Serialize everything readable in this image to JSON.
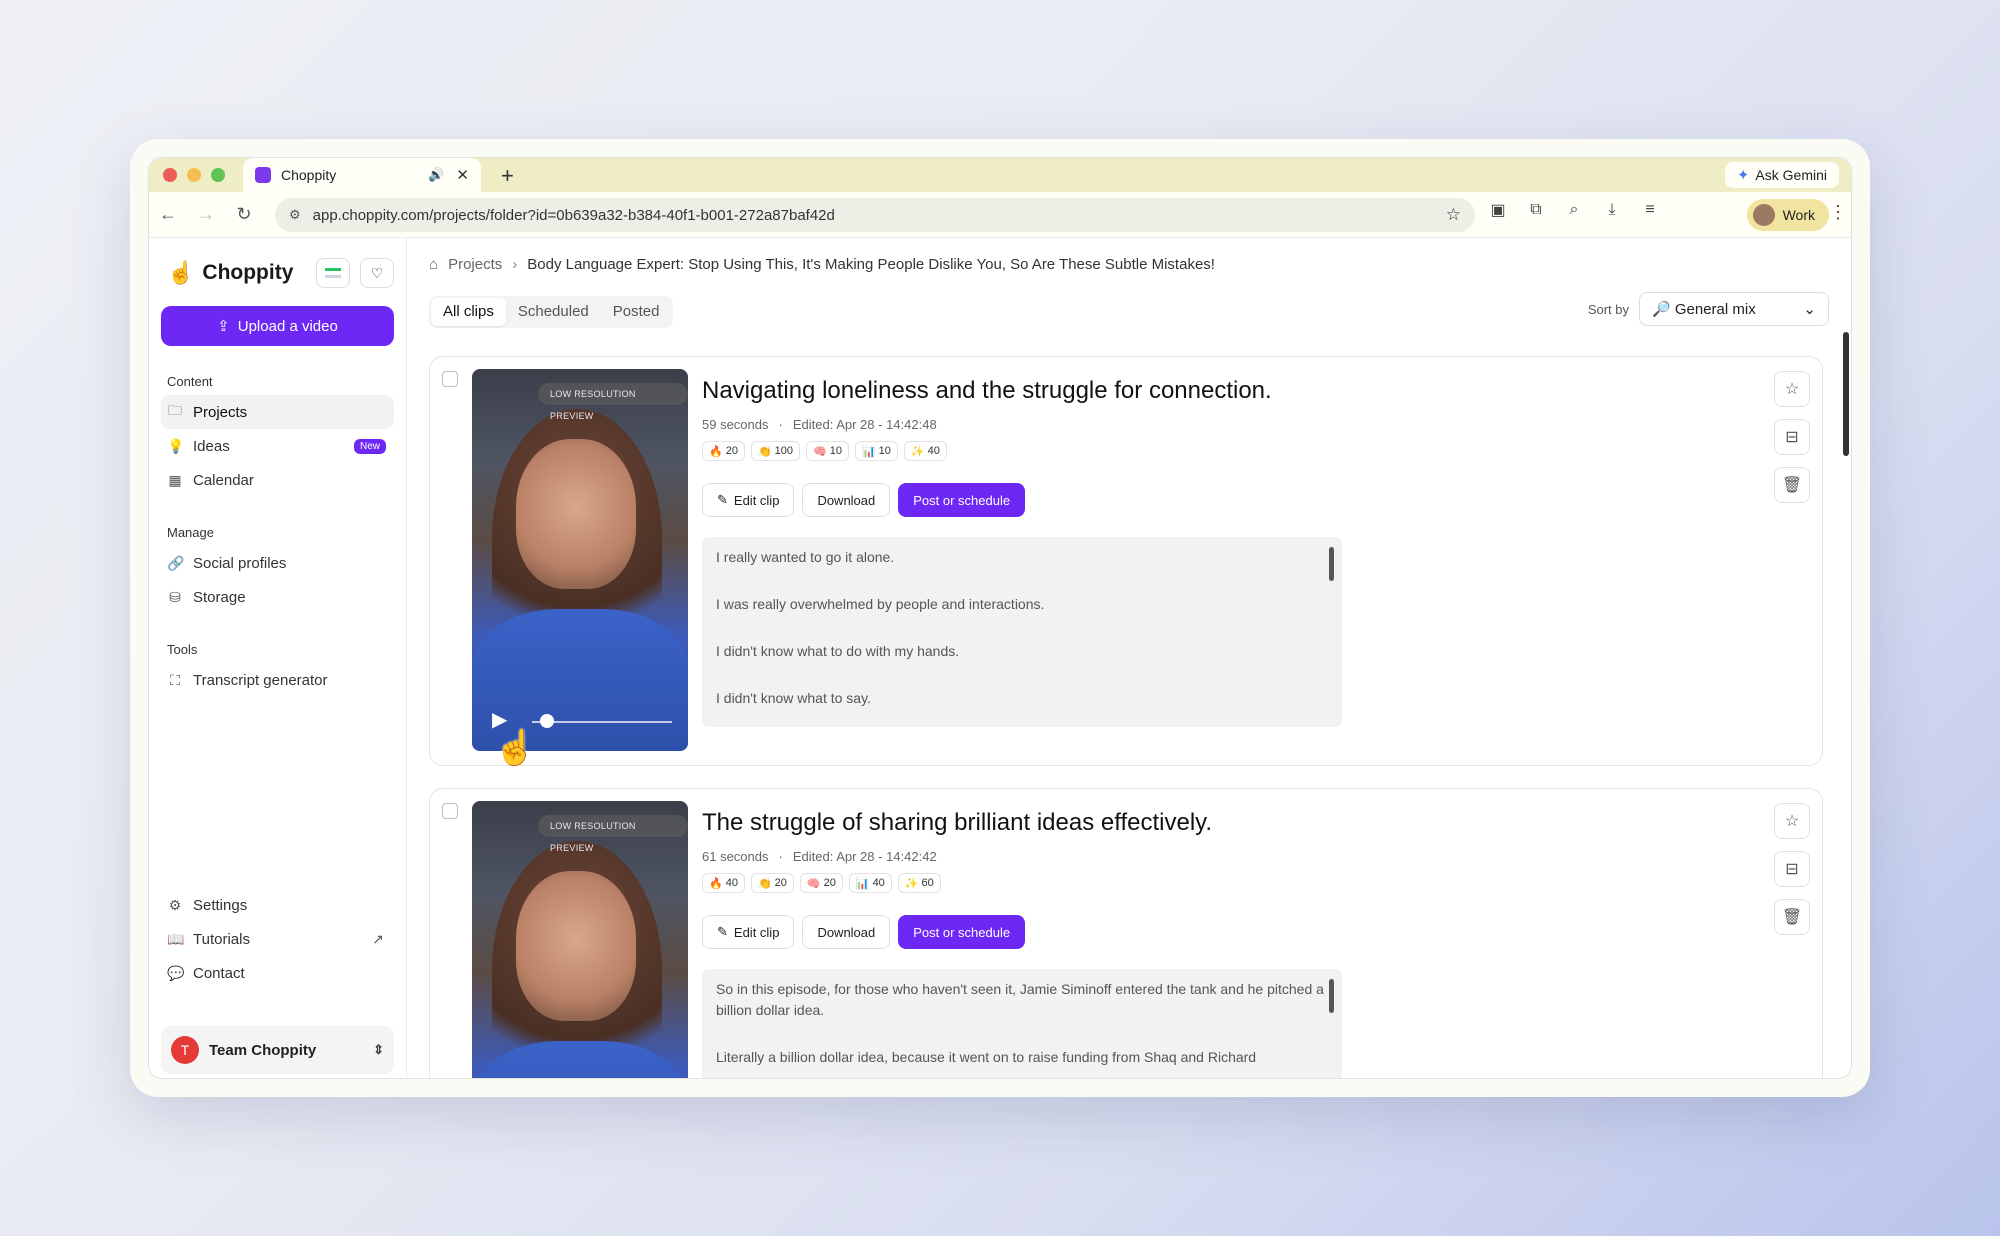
{
  "browser": {
    "tab_title": "Choppity",
    "new_tab": "+",
    "gemini": "Ask Gemini",
    "url": "app.choppity.com/projects/folder?id=0b639a32-b384-40f1-b001-272a87baf42d",
    "profile": "Work"
  },
  "sidebar": {
    "brand": "Choppity",
    "upload_label": "Upload a video",
    "content_heading": "Content",
    "projects": "Projects",
    "ideas": "Ideas",
    "ideas_badge": "New",
    "calendar": "Calendar",
    "manage_heading": "Manage",
    "social_profiles": "Social profiles",
    "storage": "Storage",
    "tools_heading": "Tools",
    "transcript_generator": "Transcript generator",
    "settings": "Settings",
    "tutorials": "Tutorials",
    "contact": "Contact",
    "team_initial": "T",
    "team_name": "Team Choppity"
  },
  "breadcrumb": {
    "root": "Projects",
    "current": "Body Language Expert: Stop Using This, It's Making People Dislike You, So Are These Subtle Mistakes!"
  },
  "tabs": {
    "all": "All clips",
    "scheduled": "Scheduled",
    "posted": "Posted"
  },
  "sort": {
    "label": "Sort by",
    "value": "General mix"
  },
  "clips": [
    {
      "preview_label": "LOW RESOLUTION PREVIEW",
      "title": "Navigating loneliness and the struggle for connection.",
      "duration": "59 seconds",
      "edited": "Edited: Apr 28 - 14:42:48",
      "stats": [
        "20",
        "100",
        "10",
        "10",
        "40"
      ],
      "edit_label": "Edit clip",
      "download_label": "Download",
      "post_label": "Post or schedule",
      "transcript": [
        "I really wanted to go it alone.",
        "I was really overwhelmed by people and interactions.",
        "I didn't know what to do with my hands.",
        "I didn't know what to say."
      ]
    },
    {
      "preview_label": "LOW RESOLUTION PREVIEW",
      "title": "The struggle of sharing brilliant ideas effectively.",
      "duration": "61 seconds",
      "edited": "Edited: Apr 28 - 14:42:42",
      "stats": [
        "40",
        "20",
        "20",
        "40",
        "60"
      ],
      "edit_label": "Edit clip",
      "download_label": "Download",
      "post_label": "Post or schedule",
      "transcript": [
        "So in this episode, for those who haven't seen it, Jamie Siminoff entered the tank and he pitched a billion dollar idea.",
        "Literally a billion dollar idea, because it went on to raise funding from Shaq and Richard"
      ]
    }
  ],
  "colors": {
    "accent": "#6d28f5",
    "tabstrip": "#efedc6",
    "profile_chip": "#f1e3a0"
  },
  "icons": {
    "stat_icons": [
      "fire-icon",
      "clap-icon",
      "brain-icon",
      "chart-icon",
      "sparkle-icon"
    ]
  }
}
